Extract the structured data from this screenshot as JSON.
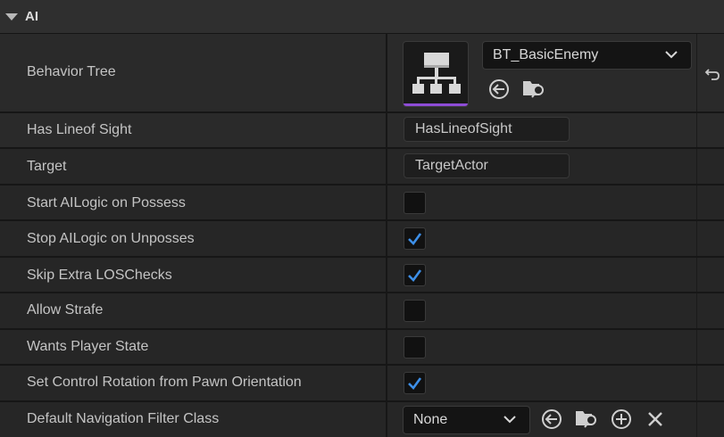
{
  "section": {
    "title": "AI"
  },
  "rows": {
    "behavior_tree": {
      "label": "Behavior Tree",
      "asset": "BT_BasicEnemy"
    },
    "has_line_of_sight": {
      "label": "Has Lineof Sight",
      "value": "HasLineofSight"
    },
    "target": {
      "label": "Target",
      "value": "TargetActor"
    },
    "start_ai_logic": {
      "label": "Start AILogic on Possess",
      "checked": false
    },
    "stop_ai_logic": {
      "label": "Stop AILogic on Unposses",
      "checked": true
    },
    "skip_extra_los": {
      "label": "Skip Extra LOSChecks",
      "checked": true
    },
    "allow_strafe": {
      "label": "Allow Strafe",
      "checked": false
    },
    "wants_player_state": {
      "label": "Wants Player State",
      "checked": false
    },
    "set_control_rotation": {
      "label": "Set Control Rotation from Pawn Orientation",
      "checked": true
    },
    "default_nav_filter": {
      "label": "Default Navigation Filter Class",
      "value": "None"
    }
  },
  "icons": {
    "behavior_tree_thumb": "behavior-tree-icon",
    "use_selected": "arrow-left-circle-icon",
    "browse": "folder-search-icon",
    "add": "plus-circle-icon",
    "clear": "close-icon",
    "reset": "reset-arrow-icon"
  },
  "colors": {
    "accent": "#3d8fe8",
    "thumb_bar": "#8e4cd6"
  }
}
